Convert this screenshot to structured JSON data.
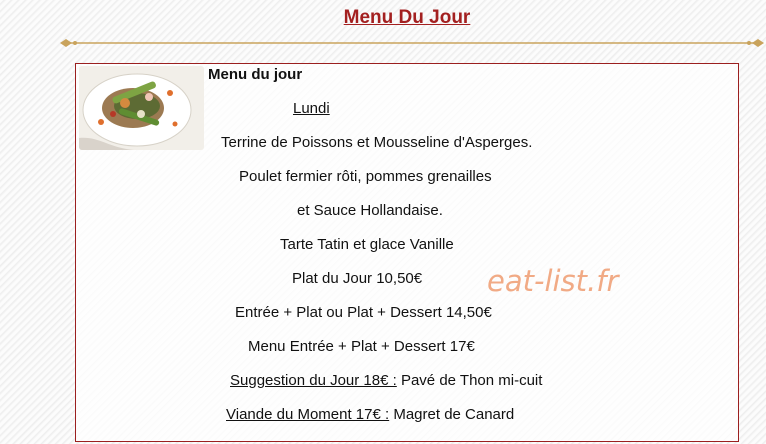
{
  "page": {
    "title": "Menu Du Jour"
  },
  "menu": {
    "heading": "Menu du jour",
    "day": "Lundi ",
    "lines": [
      "Terrine de Poissons et Mousseline d'Asperges.",
      "Poulet fermier rôti, pommes grenailles",
      "et Sauce Hollandaise.",
      "Tarte Tatin et glace Vanille",
      "Plat du Jour 10,50€",
      "Entrée + Plat ou Plat + Dessert 14,50€",
      "Menu Entrée + Plat + Dessert 17€"
    ],
    "suggestion": {
      "label": "Suggestion du Jour 18€ :",
      "value": " Pavé de Thon mi-cuit"
    },
    "viande": {
      "label": "Viande du Moment 17€ :",
      "value": " Magret de Canard"
    }
  },
  "watermark": {
    "text": "eat-list.fr"
  },
  "colors": {
    "title": "#a32020",
    "border": "#9b1f1f",
    "divider": "#c9a35c",
    "watermark": "#ee9b70"
  }
}
